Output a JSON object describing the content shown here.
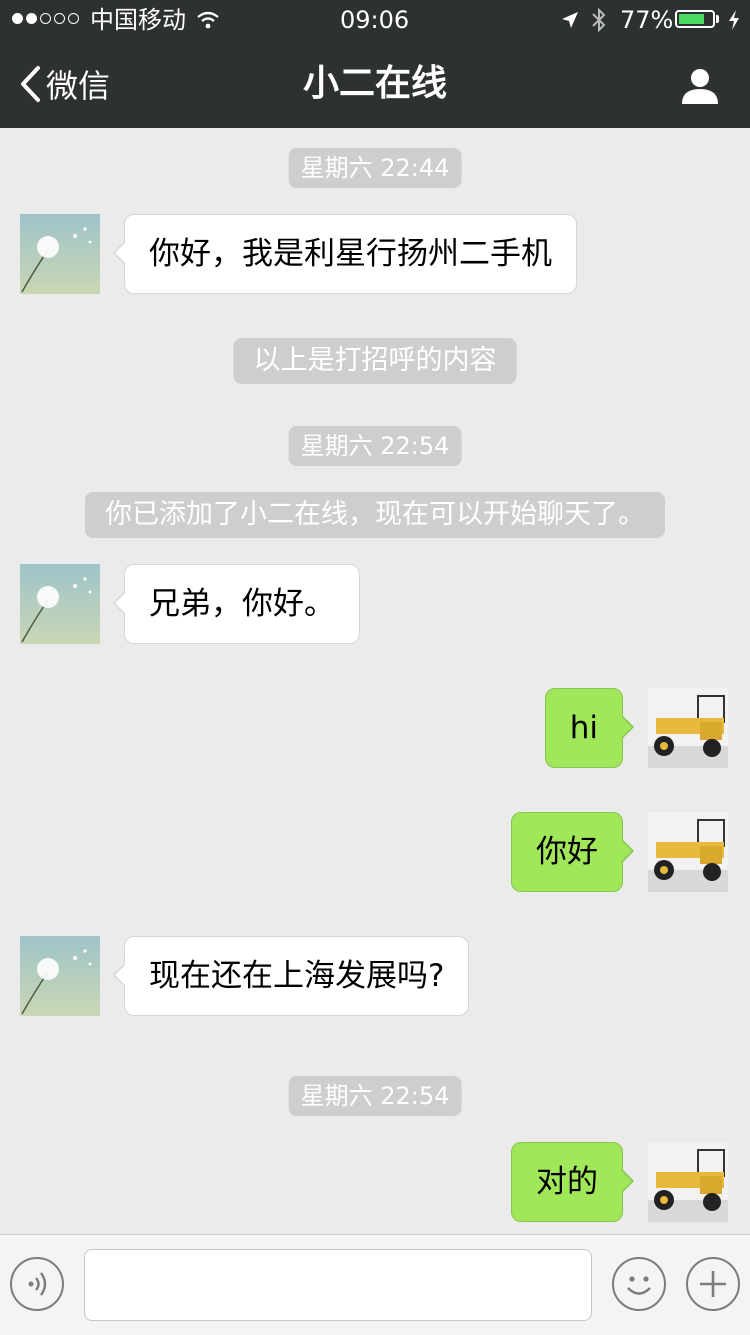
{
  "status_bar": {
    "carrier": "中国移动",
    "time": "09:06",
    "battery_percent": "77%",
    "battery_level": 0.77
  },
  "nav": {
    "back_label": "微信",
    "title": "小二在线"
  },
  "messages": [
    {
      "kind": "time",
      "text": "星期六 22:44"
    },
    {
      "kind": "incoming",
      "text": "你好，我是利星行扬州二手机"
    },
    {
      "kind": "system",
      "text": "以上是打招呼的内容"
    },
    {
      "kind": "time",
      "text": "星期六 22:54"
    },
    {
      "kind": "system",
      "text": "你已添加了小二在线，现在可以开始聊天了。"
    },
    {
      "kind": "incoming",
      "text": "兄弟，你好。"
    },
    {
      "kind": "outgoing",
      "text": "hi"
    },
    {
      "kind": "outgoing",
      "text": "你好"
    },
    {
      "kind": "incoming",
      "text": "现在还在上海发展吗?"
    },
    {
      "kind": "time",
      "text": "星期六 22:54"
    },
    {
      "kind": "outgoing",
      "text": "对的"
    }
  ],
  "input_bar": {
    "message_value": ""
  },
  "icons": {
    "signal": "signal-dots-icon",
    "wifi": "wifi-icon",
    "location": "location-arrow-icon",
    "bluetooth": "bluetooth-icon",
    "battery": "battery-icon",
    "charging": "charging-bolt-icon",
    "back": "chevron-left-icon",
    "profile": "person-icon",
    "voice": "voice-icon",
    "emoji": "emoji-icon",
    "more": "plus-icon"
  },
  "colors": {
    "nav_bg": "#2e3132",
    "chat_bg": "#ebebeb",
    "outgoing_bubble": "#a0e75a",
    "incoming_bubble": "#ffffff",
    "pill": "#cecece",
    "battery_fill": "#4cd964"
  }
}
